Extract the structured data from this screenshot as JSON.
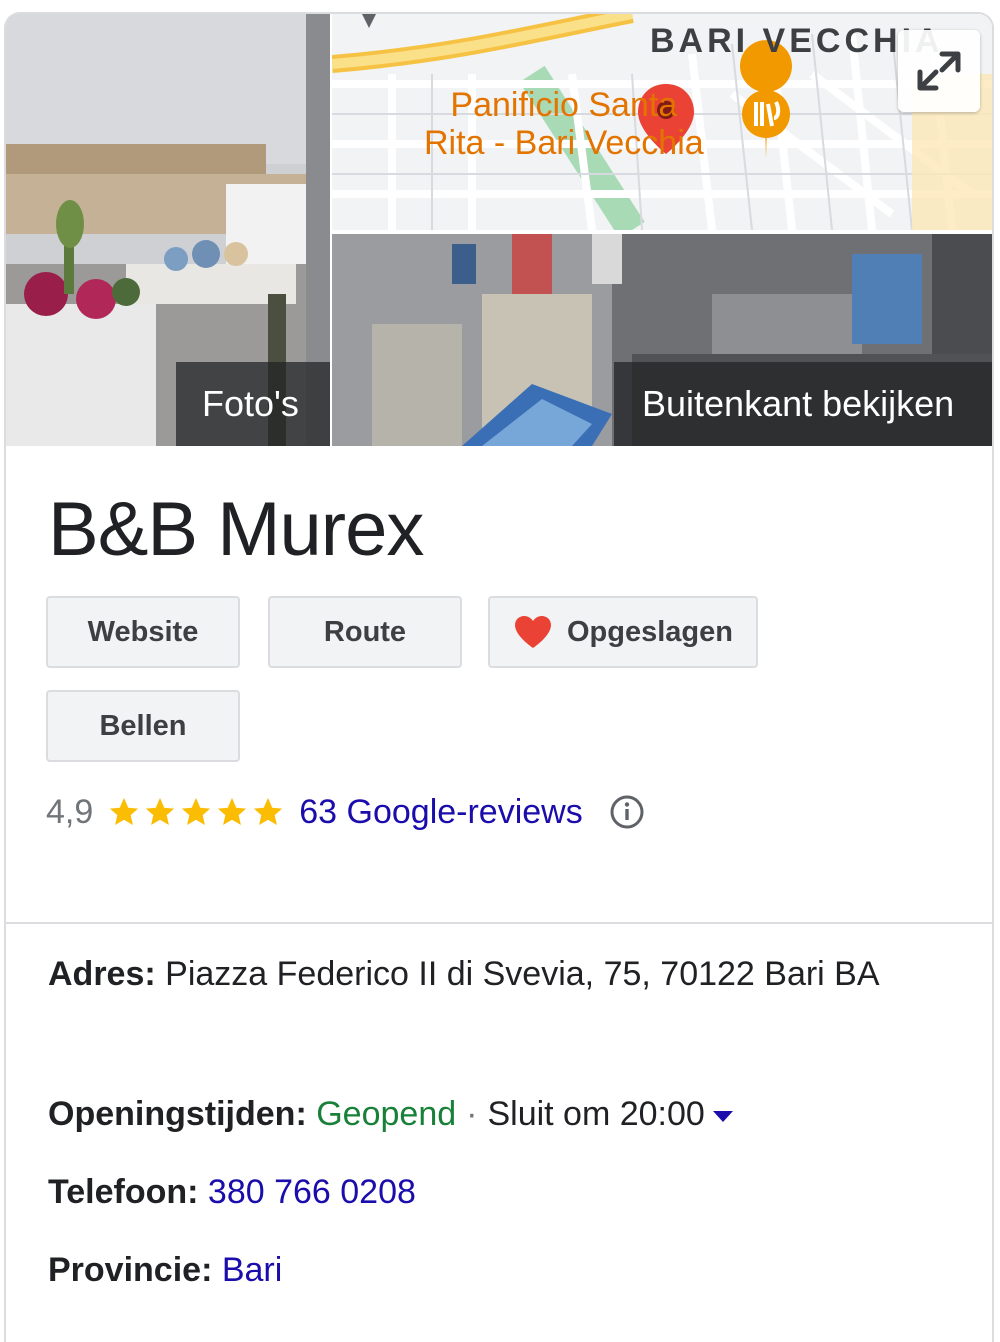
{
  "media": {
    "photos_label": "Foto's",
    "outside_label": "Buitenkant bekijken",
    "map": {
      "district": "BARI VECCHIA",
      "poi_name": "Panificio Santa\nRita - Bari Vecchia",
      "expand_icon": "expand-icon"
    }
  },
  "title": "B&B Murex",
  "actions": {
    "website": "Website",
    "route": "Route",
    "saved": "Opgeslagen",
    "call": "Bellen",
    "saved_icon_color": "#ea4335"
  },
  "rating": {
    "value_text": "4,9",
    "stars": 5,
    "star_color": "#fbbc04",
    "reviews_text": "63 Google-reviews",
    "info_icon": "info-icon"
  },
  "details": {
    "address_label": "Adres:",
    "address_value": "Piazza Federico II di Svevia, 75, 70122 Bari BA",
    "hours_label": "Openingstijden:",
    "hours_status": "Geopend",
    "hours_separator": "·",
    "hours_close": "Sluit om 20:00",
    "phone_label": "Telefoon:",
    "phone_value": "380 766 0208",
    "province_label": "Provincie:",
    "province_value": "Bari"
  },
  "colors": {
    "link": "#1a0dab",
    "open_green": "#188038"
  }
}
